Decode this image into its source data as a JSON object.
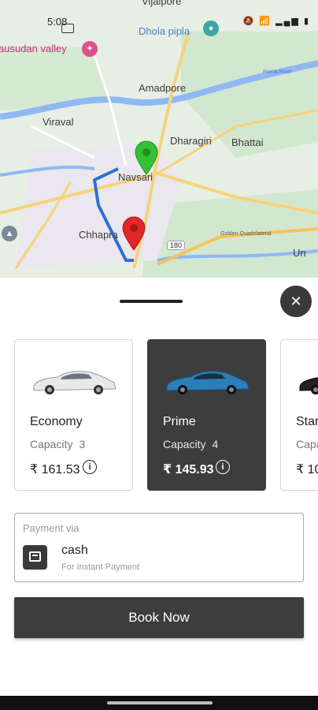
{
  "status_bar": {
    "time": "5:08",
    "icons": [
      "sim-icon",
      "mute-icon",
      "wifi-icon",
      "signal-icon",
      "battery-icon"
    ]
  },
  "map": {
    "labels": {
      "vijalpore": "Vijalpore",
      "madhusudan": "ausudan valley",
      "dholapipla": "Dhola pipla",
      "amadpore": "Amadpore",
      "viraval": "Viraval",
      "dharagiri": "Dharagiri",
      "bhattai": "Bhattai",
      "navsari": "Navsari",
      "chhapra": "Chhapra",
      "un": "Un",
      "purna_river": "Purna River",
      "golden_quad": "Golden Quadrilateral",
      "highway": "180"
    },
    "colors": {
      "pickup_pin": "#34c134",
      "drop_pin": "#e3262a",
      "route": "#2f6fd1"
    }
  },
  "sheet": {
    "close_icon": "close-icon",
    "vehicles": [
      {
        "name": "Economy",
        "capacity_label": "Capacity",
        "capacity": "3",
        "price": "₹ 161.53",
        "selected": false,
        "car_color": "#e8e8e8"
      },
      {
        "name": "Prime",
        "capacity_label": "Capacity",
        "capacity": "4",
        "price": "₹ 145.93",
        "selected": true,
        "car_color": "#2a7fb8"
      },
      {
        "name": "Star",
        "capacity_label": "Capa",
        "capacity": "",
        "price": "₹ 10",
        "selected": false,
        "car_color": "#222222"
      }
    ],
    "payment": {
      "via_label": "Payment via",
      "method": "cash",
      "sub": "For Instant Payment",
      "icon": "wallet-icon"
    },
    "book_button": "Book Now"
  }
}
